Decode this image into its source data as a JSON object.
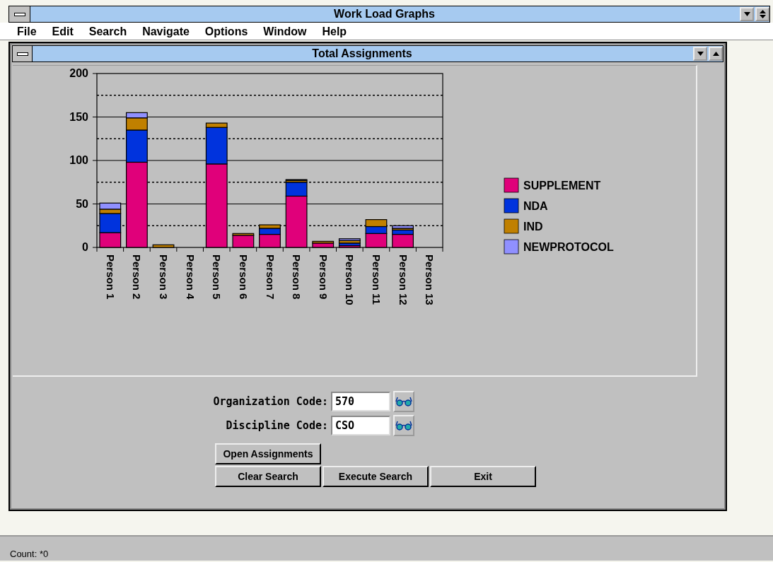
{
  "window": {
    "title": "Work Load Graphs"
  },
  "menu": [
    "File",
    "Edit",
    "Search",
    "Navigate",
    "Options",
    "Window",
    "Help"
  ],
  "child_window": {
    "title": "Total Assignments",
    "chart_data": {
      "type": "bar",
      "stacked": true,
      "grid": true,
      "legend": true,
      "categories": [
        "Person 1",
        "Person 2",
        "Person 3",
        "Person 4",
        "Person 5",
        "Person 6",
        "Person 7",
        "Person 8",
        "Person 9",
        "Person 10",
        "Person 11",
        "Person 12",
        "Person 13"
      ],
      "series": [
        {
          "name": "SUPPLEMENT",
          "color": "#e0007a",
          "values": [
            17,
            98,
            0,
            0,
            96,
            14,
            15,
            59,
            5,
            2,
            16,
            15,
            0
          ]
        },
        {
          "name": "NDA",
          "color": "#0033dd",
          "values": [
            22,
            37,
            0,
            0,
            42,
            0,
            7,
            16,
            0,
            3,
            8,
            5,
            0
          ]
        },
        {
          "name": "IND",
          "color": "#c08000",
          "values": [
            5,
            14,
            3,
            0,
            5,
            2,
            4,
            2,
            2,
            3,
            8,
            2,
            0
          ]
        },
        {
          "name": "NEWPROTOCOL",
          "color": "#9090ff",
          "values": [
            7,
            6,
            0,
            0,
            0,
            0,
            0,
            1,
            0,
            2,
            0,
            3,
            0
          ]
        }
      ],
      "ylim": [
        0,
        200
      ],
      "yticks": [
        0,
        50,
        100,
        150,
        200
      ]
    }
  },
  "form": {
    "fields": [
      {
        "label": "Organization Code:",
        "value": "570"
      },
      {
        "label": "Discipline Code:",
        "value": "CSO"
      }
    ],
    "button_rows": [
      [
        "Open Assignments"
      ],
      [
        "Clear Search",
        "Execute Search",
        "Exit"
      ]
    ]
  },
  "status_bar": "Count: *0"
}
